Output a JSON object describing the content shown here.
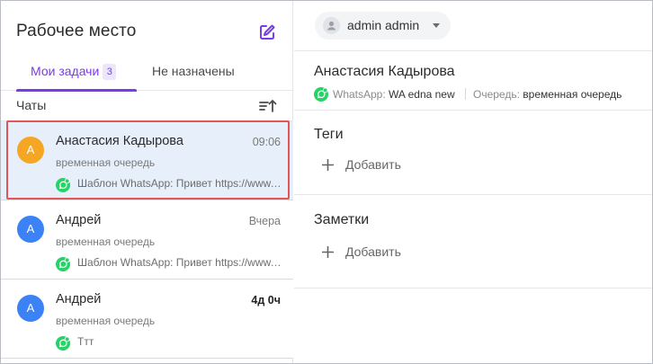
{
  "workspace": {
    "title": "Рабочее место"
  },
  "tabs": [
    {
      "label": "Мои задачи",
      "count": "3"
    },
    {
      "label": "Не назначены"
    }
  ],
  "chats_header": {
    "label": "Чаты"
  },
  "chats": [
    {
      "avatar_letter": "А",
      "avatar_color": "#f5a623",
      "name": "Анастасия Кадырова",
      "time": "09:06",
      "queue": "временная очередь",
      "preview": "Шаблон WhatsApp: Привет https://www.example.com"
    },
    {
      "avatar_letter": "А",
      "avatar_color": "#3b82f6",
      "name": "Андрей",
      "time": "Вчера",
      "queue": "временная очередь",
      "preview": "Шаблон WhatsApp: Привет https://www.example.com"
    },
    {
      "avatar_letter": "А",
      "avatar_color": "#3b82f6",
      "name": "Андрей",
      "time": "4д 0ч",
      "queue": "временная очередь",
      "preview": "Ттт"
    }
  ],
  "user": {
    "name": "admin admin"
  },
  "contact": {
    "name": "Анастасия Кадырова",
    "channel_label": "WhatsApp:",
    "channel_value": "WA edna new",
    "queue_label": "Очередь:",
    "queue_value": "временная очередь"
  },
  "tags": {
    "title": "Теги",
    "add_label": "Добавить"
  },
  "notes": {
    "title": "Заметки",
    "add_label": "Добавить"
  },
  "colors": {
    "accent": "#7c3aed",
    "selected_bg": "#e7effb",
    "whatsapp": "#25d366",
    "highlight": "#e05658"
  }
}
